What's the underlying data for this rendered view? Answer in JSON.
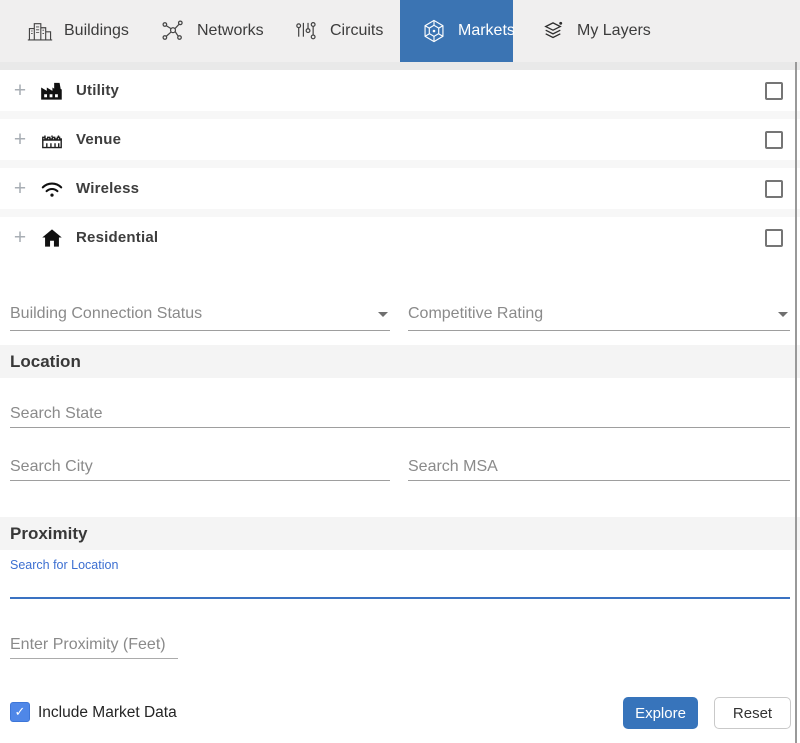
{
  "colors": {
    "active_tab_blue": "#3b74b3",
    "focus_blue": "#3a72c2",
    "checkbox_blue": "#4f87e8",
    "tabbar_gray": "#f0efef"
  },
  "tabs": [
    {
      "label": "Buildings",
      "icon": "buildings-icon",
      "active": false
    },
    {
      "label": "Networks",
      "icon": "networks-icon",
      "active": false
    },
    {
      "label": "Circuits",
      "icon": "circuits-icon",
      "active": false
    },
    {
      "label": "Markets",
      "icon": "markets-icon",
      "active": true
    },
    {
      "label": "My Layers",
      "icon": "layers-icon",
      "active": false
    }
  ],
  "market_layers": {
    "expand_glyph": "+",
    "rows": [
      {
        "label": "Utility",
        "icon": "factory-icon",
        "checked": false
      },
      {
        "label": "Venue",
        "icon": "stadium-icon",
        "checked": false
      },
      {
        "label": "Wireless",
        "icon": "wifi-icon",
        "checked": false
      },
      {
        "label": "Residential",
        "icon": "home-icon",
        "checked": false
      }
    ]
  },
  "filters": {
    "building_connection_status": "Building Connection Status",
    "competitive_rating": "Competitive Rating"
  },
  "location": {
    "header": "Location",
    "state_placeholder": "Search State",
    "city_placeholder": "Search City",
    "msa_placeholder": "Search MSA"
  },
  "proximity": {
    "header": "Proximity",
    "search_label": "Search for Location",
    "feet_placeholder": "Enter Proximity (Feet)"
  },
  "footer": {
    "include_market_data": "Include Market Data",
    "include_checked": true,
    "check_glyph": "✓",
    "explore": "Explore",
    "reset": "Reset"
  }
}
